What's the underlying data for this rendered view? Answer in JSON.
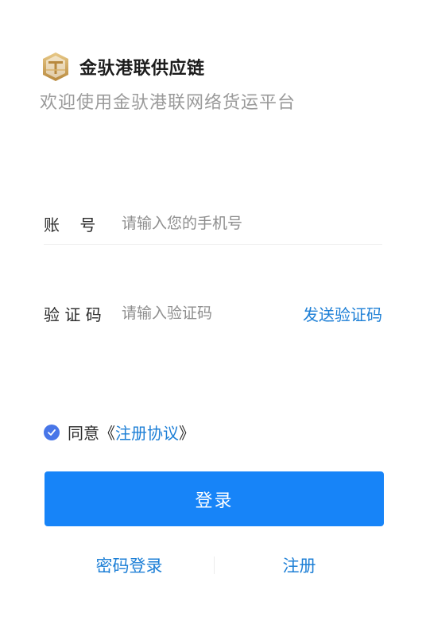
{
  "header": {
    "app_name": "金驮港联供应链",
    "welcome": "欢迎使用金驮港联网络货运平台"
  },
  "form": {
    "account": {
      "label": "账    号",
      "placeholder": "请输入您的手机号",
      "value": ""
    },
    "code": {
      "label": "验 证 码",
      "placeholder": "请输入验证码",
      "value": "",
      "send_label": "发送验证码"
    }
  },
  "agreement": {
    "checked": true,
    "prefix": "同意《",
    "link": "注册协议",
    "suffix": "》"
  },
  "login_button": "登录",
  "bottom_links": {
    "password_login": "密码登录",
    "register": "注册"
  },
  "colors": {
    "primary": "#1784f8",
    "link": "#1d7fd6",
    "checkbox": "#4876e8",
    "muted_text": "#9a9a9a",
    "logo_gold": "#c8a35c"
  },
  "icons": {
    "logo": "golden-shield-logo-icon",
    "checkbox": "check-circle-icon"
  }
}
